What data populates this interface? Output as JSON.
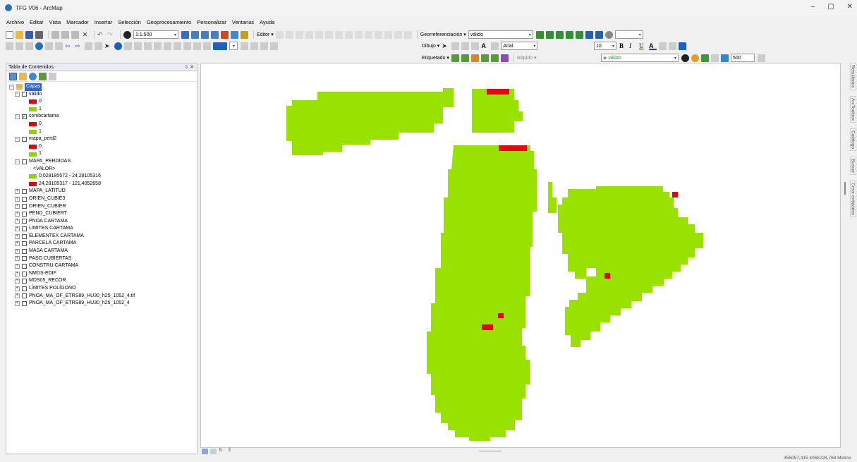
{
  "window": {
    "title": "TFG V06 - ArcMap",
    "controls": [
      "–",
      "▢",
      "✕"
    ]
  },
  "menu": [
    "Archivo",
    "Editar",
    "Vista",
    "Marcador",
    "Insertar",
    "Selección",
    "Geoprocesamiento",
    "Personalizar",
    "Ventanas",
    "Ayuda"
  ],
  "toolbar": {
    "scale": "1:1.500",
    "editor_label": "Editor",
    "georef_label": "Georreferenciación",
    "georef_layer": "válido",
    "dibujo_label": "Dibujo",
    "font_name": "Arial",
    "font_size": "10",
    "etiquetado_label": "Etiquetado",
    "rapido_label": "Rápido",
    "layer_combo": "válido",
    "resolution": "500"
  },
  "toc": {
    "title": "Tabla de Contenidos",
    "root": "Capas",
    "layers": [
      {
        "name": "válido",
        "expanded": true,
        "checked": false,
        "classes": [
          {
            "label": "0",
            "color": "#e8000b"
          },
          {
            "label": "1",
            "color": "#8fd400"
          }
        ]
      },
      {
        "name": "sombcartama",
        "expanded": true,
        "checked": true,
        "classes": [
          {
            "label": "0",
            "color": "#e8000b"
          },
          {
            "label": "1",
            "color": "#8fd400"
          }
        ]
      },
      {
        "name": "mapa_perd2",
        "expanded": true,
        "checked": false,
        "classes": [
          {
            "label": "0",
            "color": "#e8000b"
          },
          {
            "label": "1",
            "color": "#8fd400"
          }
        ]
      },
      {
        "name": "MAPA_PERDIDAS",
        "expanded": true,
        "checked": false,
        "subheading": "<VALOR>",
        "classes": [
          {
            "label": "0,028185572 - 24,28105316",
            "color": "#8fd400"
          },
          {
            "label": "24,28105317 - 121,4052658",
            "color": "#e8000b"
          }
        ]
      },
      {
        "name": "MAPA_LATITUD",
        "expanded": false,
        "checked": false
      },
      {
        "name": "ORIEN_CUBIE3",
        "expanded": false,
        "checked": false
      },
      {
        "name": "ORIEN_CUBIER",
        "expanded": false,
        "checked": false
      },
      {
        "name": "PEND_CUBIERT",
        "expanded": false,
        "checked": false
      },
      {
        "name": "PNOA CARTAMA",
        "expanded": false,
        "checked": false
      },
      {
        "name": "LIMITES CARTAMA",
        "expanded": false,
        "checked": false
      },
      {
        "name": "ELEMENTEX CARTAMA",
        "expanded": false,
        "checked": false
      },
      {
        "name": "PARCELA CARTAMA",
        "expanded": false,
        "checked": false
      },
      {
        "name": "MASA CARTAMA",
        "expanded": false,
        "checked": false
      },
      {
        "name": "PASO CUBIERTAS",
        "expanded": false,
        "checked": false
      },
      {
        "name": "CONSTRU CARTAMA",
        "expanded": false,
        "checked": false
      },
      {
        "name": "NMDS-EDIF",
        "expanded": false,
        "checked": false
      },
      {
        "name": "MDS05_RECOR",
        "expanded": false,
        "checked": false
      },
      {
        "name": "LÍMITES POLÍGONO",
        "expanded": false,
        "checked": false
      },
      {
        "name": "PNOA_MA_OF_ETRS89_HU30_h25_1052_4.tif",
        "expanded": false,
        "checked": false
      },
      {
        "name": "PNOA_MA_OF_ETRS89_HU30_h25_1052_4",
        "expanded": false,
        "checked": false
      }
    ]
  },
  "map": {
    "fill_color": "#99e100",
    "loss_color": "#e30613"
  },
  "side_tabs": [
    "Resultados",
    "ArcToolbox",
    "Catálogo",
    "Buscar",
    "Crear entidades"
  ],
  "status": {
    "coordinates": "355057,415  4065228,768 Metros"
  }
}
